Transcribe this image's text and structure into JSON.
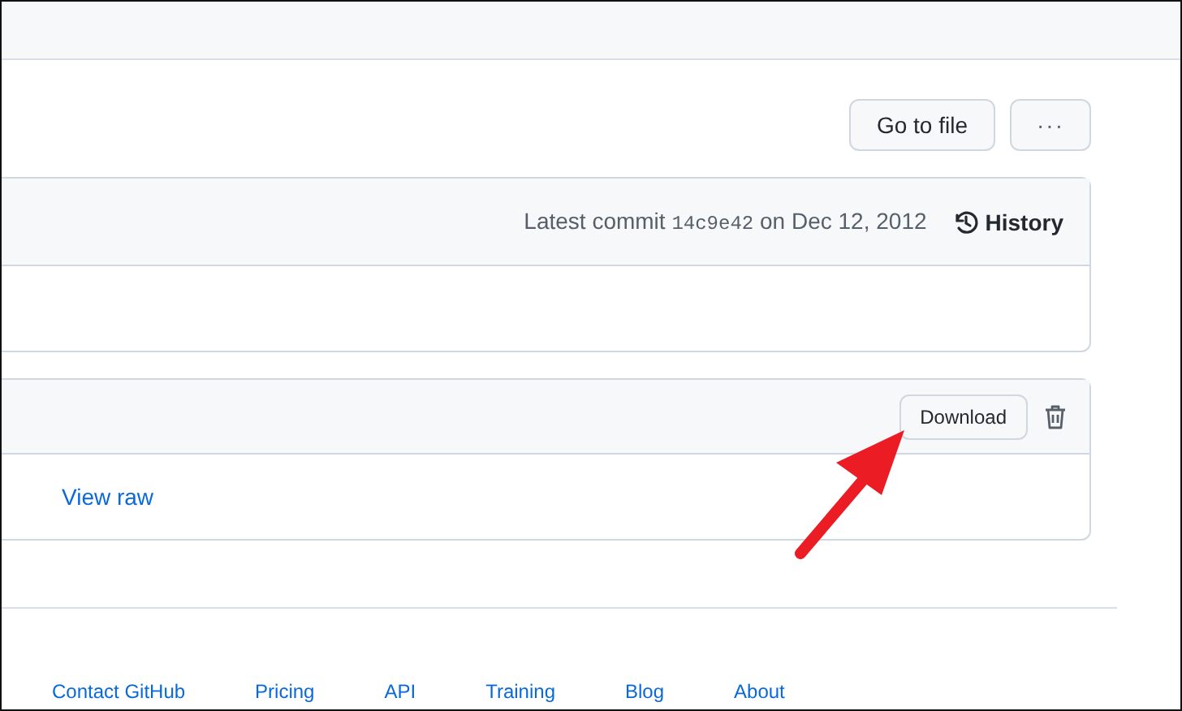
{
  "toolbar": {
    "go_to_file": "Go to file",
    "more": "···"
  },
  "commit_box": {
    "label": "Latest commit",
    "sha": "14c9e42",
    "date": "on Dec 12, 2012",
    "history": "History"
  },
  "file_box": {
    "download": "Download",
    "view_raw": "View raw"
  },
  "footer": {
    "links": [
      "Contact GitHub",
      "Pricing",
      "API",
      "Training",
      "Blog",
      "About"
    ]
  }
}
